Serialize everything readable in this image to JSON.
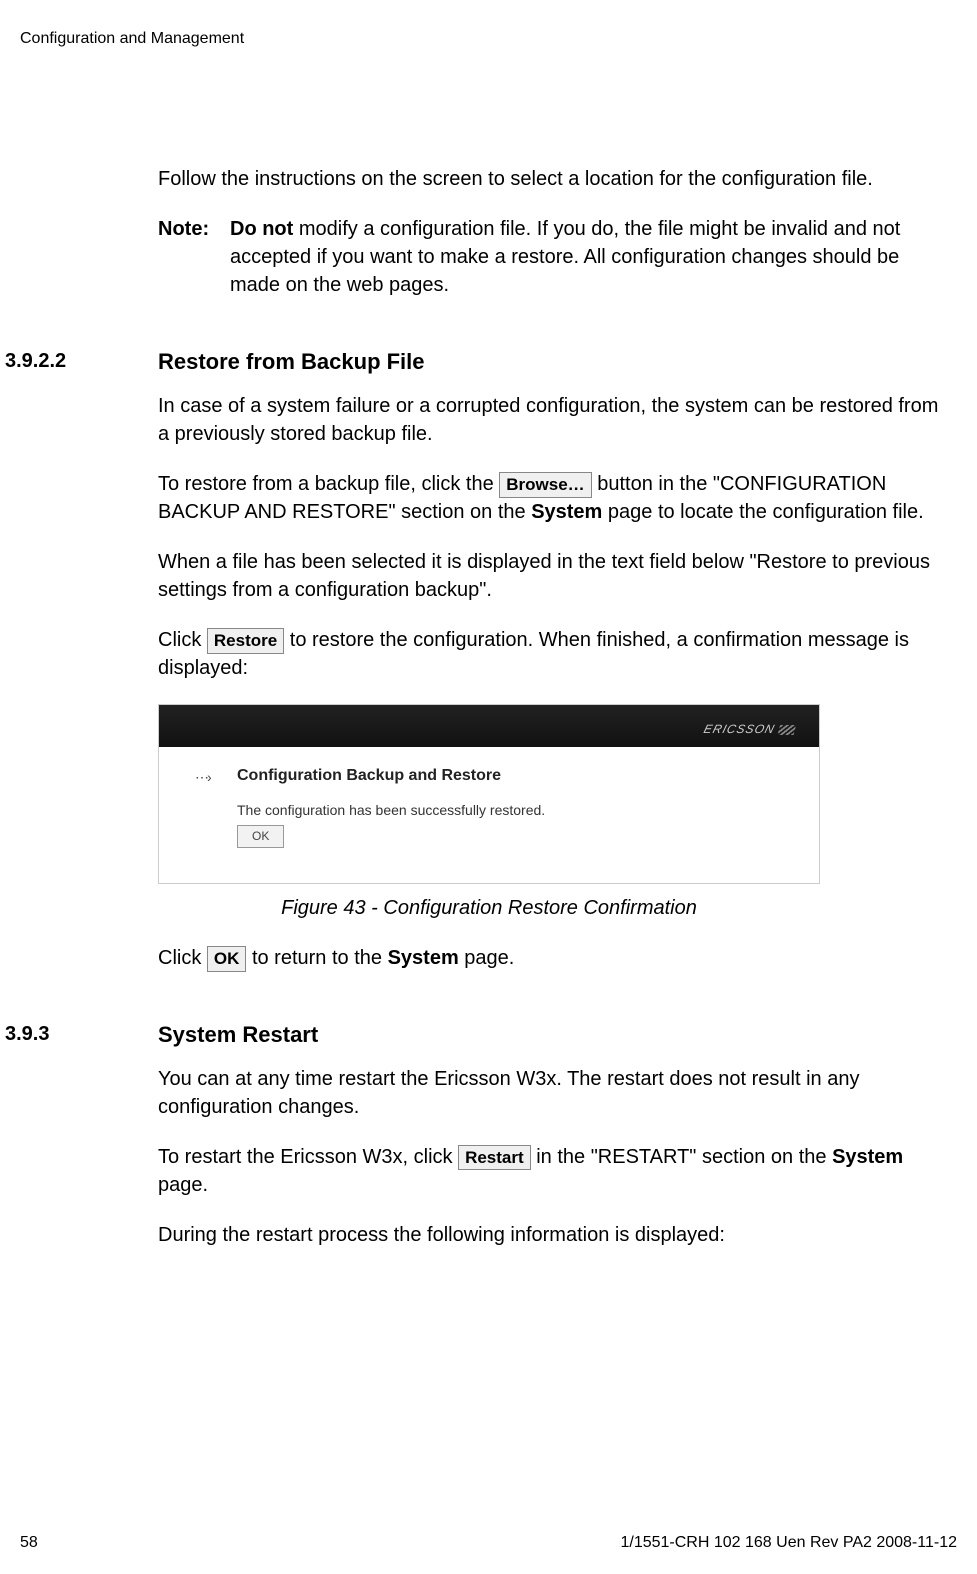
{
  "header": "Configuration and Management",
  "p1": "Follow the instructions on the screen to select a location for the configuration file.",
  "note": {
    "label": "Note:",
    "prebold": "Do not",
    "rest": " modify a configuration file. If you do, the file might be invalid and not accepted if you want to make a restore. All configuration changes should be made on the web pages."
  },
  "s1": {
    "num": "3.9.2.2",
    "title": "Restore from Backup File",
    "p1": "In case of a system failure or a corrupted configuration, the system can be restored from a previously stored backup file.",
    "p2a": "To restore from a backup file, click the ",
    "browse_btn": "Browse…",
    "p2b": " button in the \"CONFIGURATION BACKUP AND RESTORE\" section on the ",
    "system_word": "System",
    "p2c": " page to locate the configuration file.",
    "p3": "When a file has been selected it is displayed in the text field below \"Restore to previous settings from a configuration backup\".",
    "p4a": "Click ",
    "restore_btn": "Restore",
    "p4b": " to restore the configuration. When finished, a confirmation message is displayed:",
    "figure_caption": "Figure 43 - Configuration Restore Confirmation",
    "p5a": "Click ",
    "ok_btn": "OK",
    "p5b": " to return to the ",
    "p5c": " page."
  },
  "screenshot": {
    "brand": "ERICSSON",
    "arrow": "⋯›",
    "title": "Configuration Backup and Restore",
    "msg": "The configuration has been successfully restored.",
    "ok": "OK"
  },
  "s2": {
    "num": "3.9.3",
    "title": "System Restart",
    "p1": "You can at any time restart the Ericsson W3x. The restart does not result in any configuration changes.",
    "p2a": "To restart the Ericsson W3x, click ",
    "restart_btn": "Restart",
    "p2b": " in the \"RESTART\" section on the ",
    "system_word": "System",
    "p2c": " page.",
    "p3": "During the restart process the following information is displayed:"
  },
  "footer": {
    "page": "58",
    "docid": "1/1551-CRH 102 168 Uen Rev PA2  2008-11-12"
  }
}
